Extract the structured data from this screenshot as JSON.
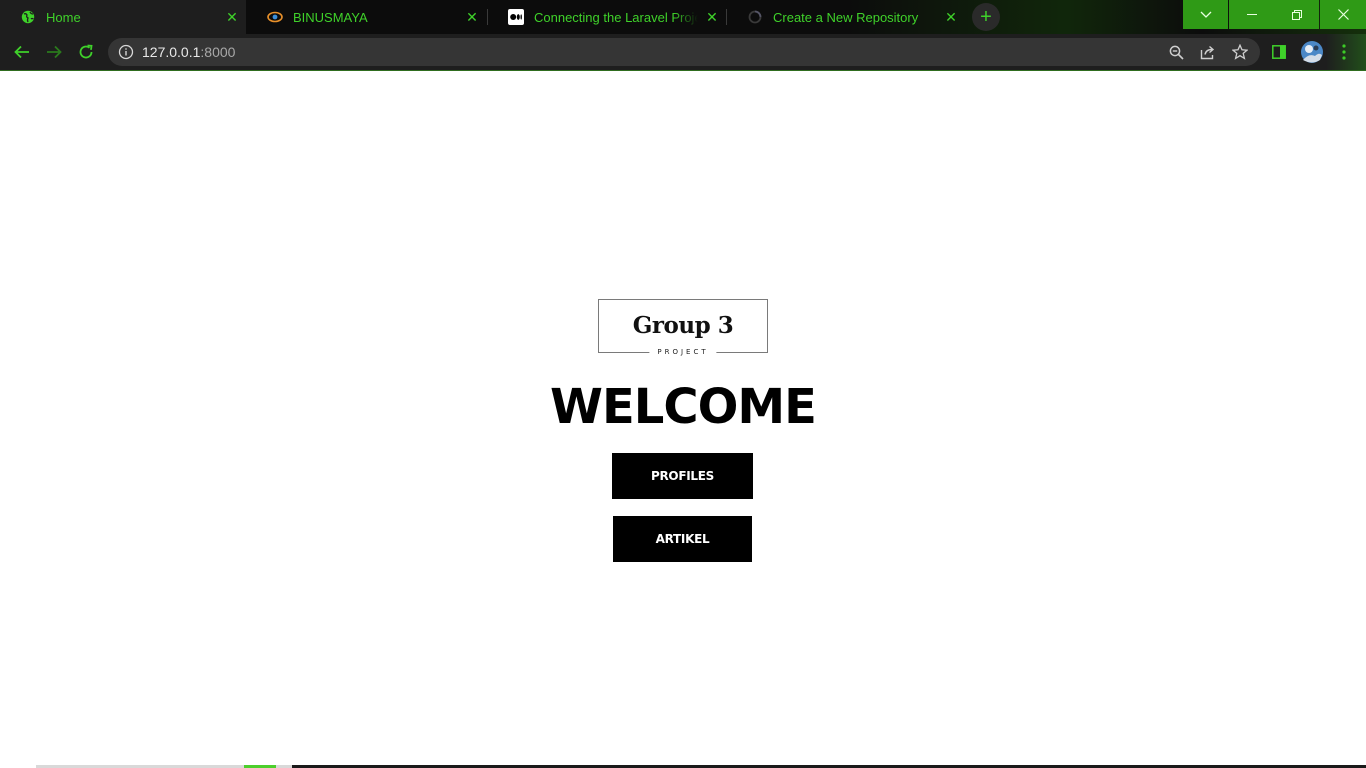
{
  "browser": {
    "tabs": [
      {
        "title": "Home",
        "icon": "globe-icon",
        "active": true
      },
      {
        "title": "BINUSMAYA",
        "icon": "binusmaya-icon",
        "active": false
      },
      {
        "title": "Connecting the Laravel Project on",
        "icon": "medium-icon",
        "active": false
      },
      {
        "title": "Create a New Repository",
        "icon": "loading-icon",
        "active": false
      }
    ],
    "new_tab_label": "+",
    "address": {
      "host": "127.0.0.1",
      "port": ":8000"
    },
    "accent_color": "#3fd12a",
    "window_button_color": "#2f9a16"
  },
  "page": {
    "logo": {
      "name": "Group 3",
      "subtitle": "PROJECT"
    },
    "heading": "WELCOME",
    "buttons": {
      "profiles": "PROFILES",
      "artikel": "ARTIKEL"
    }
  }
}
